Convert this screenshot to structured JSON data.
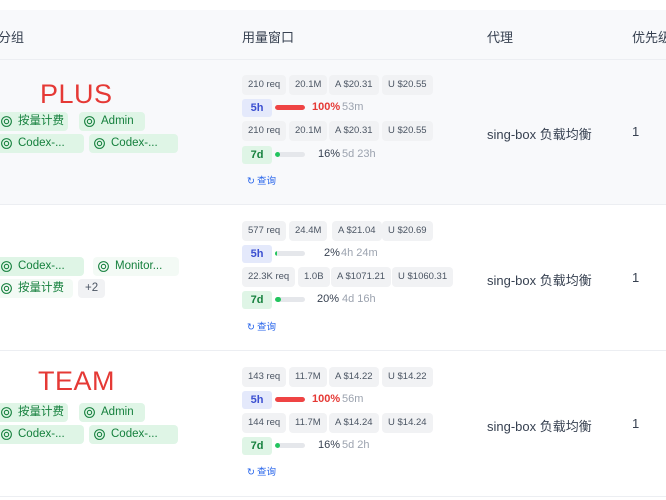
{
  "columns": {
    "group": "分组",
    "usage_window": "用量窗口",
    "proxy": "代理",
    "priority": "优先级"
  },
  "rows": [
    {
      "annotation": "PLUS",
      "groups": [
        "按量计费",
        "Admin",
        "Codex-...",
        "Codex-..."
      ],
      "w5h": {
        "requests": "210 req",
        "tokens": "20.1M",
        "a_cost": "A $20.31",
        "u_cost": "U $20.55",
        "label": "5h",
        "percent": "100%",
        "percent_value": 100,
        "reset": "53m"
      },
      "w7d": {
        "requests": "210 req",
        "tokens": "20.1M",
        "a_cost": "A $20.31",
        "u_cost": "U $20.55",
        "label": "7d",
        "percent": "16%",
        "percent_value": 16,
        "reset": "5d 23h"
      },
      "query": "查询",
      "proxy": "sing-box 负载均衡",
      "priority": "1"
    },
    {
      "annotation": "",
      "groups": [
        "Codex-...",
        "Monitor...",
        "按量计费",
        "+2"
      ],
      "w5h": {
        "requests": "577 req",
        "tokens": "24.4M",
        "a_cost": "A $21.04",
        "u_cost": "U $20.69",
        "label": "5h",
        "percent": "2%",
        "percent_value": 2,
        "reset": "4h 24m"
      },
      "w7d": {
        "requests": "22.3K req",
        "tokens": "1.0B",
        "a_cost": "A $1071.21",
        "u_cost": "U $1060.31",
        "label": "7d",
        "percent": "20%",
        "percent_value": 20,
        "reset": "4d 16h"
      },
      "query": "查询",
      "proxy": "sing-box 负载均衡",
      "priority": "1"
    },
    {
      "annotation": "TEAM",
      "groups": [
        "按量计费",
        "Admin",
        "Codex-...",
        "Codex-..."
      ],
      "w5h": {
        "requests": "143 req",
        "tokens": "11.7M",
        "a_cost": "A $14.22",
        "u_cost": "U $14.22",
        "label": "5h",
        "percent": "100%",
        "percent_value": 100,
        "reset": "56m"
      },
      "w7d": {
        "requests": "144 req",
        "tokens": "11.7M",
        "a_cost": "A $14.24",
        "u_cost": "U $14.24",
        "label": "7d",
        "percent": "16%",
        "percent_value": 16,
        "reset": "5d 2h"
      },
      "query": "查询",
      "proxy": "sing-box 负载均衡",
      "priority": "1"
    }
  ],
  "colors": {
    "bar_full": "#ef4444",
    "bar_partial": "#22c55e",
    "bar_track": "#e5e7eb",
    "tag_green": "#dff5e6",
    "win_5h": "#e4e9fb",
    "link": "#2563eb",
    "annotation": "#e53935"
  },
  "icons": {
    "group_tag": "openai-logo-icon",
    "query": "refresh-icon"
  }
}
